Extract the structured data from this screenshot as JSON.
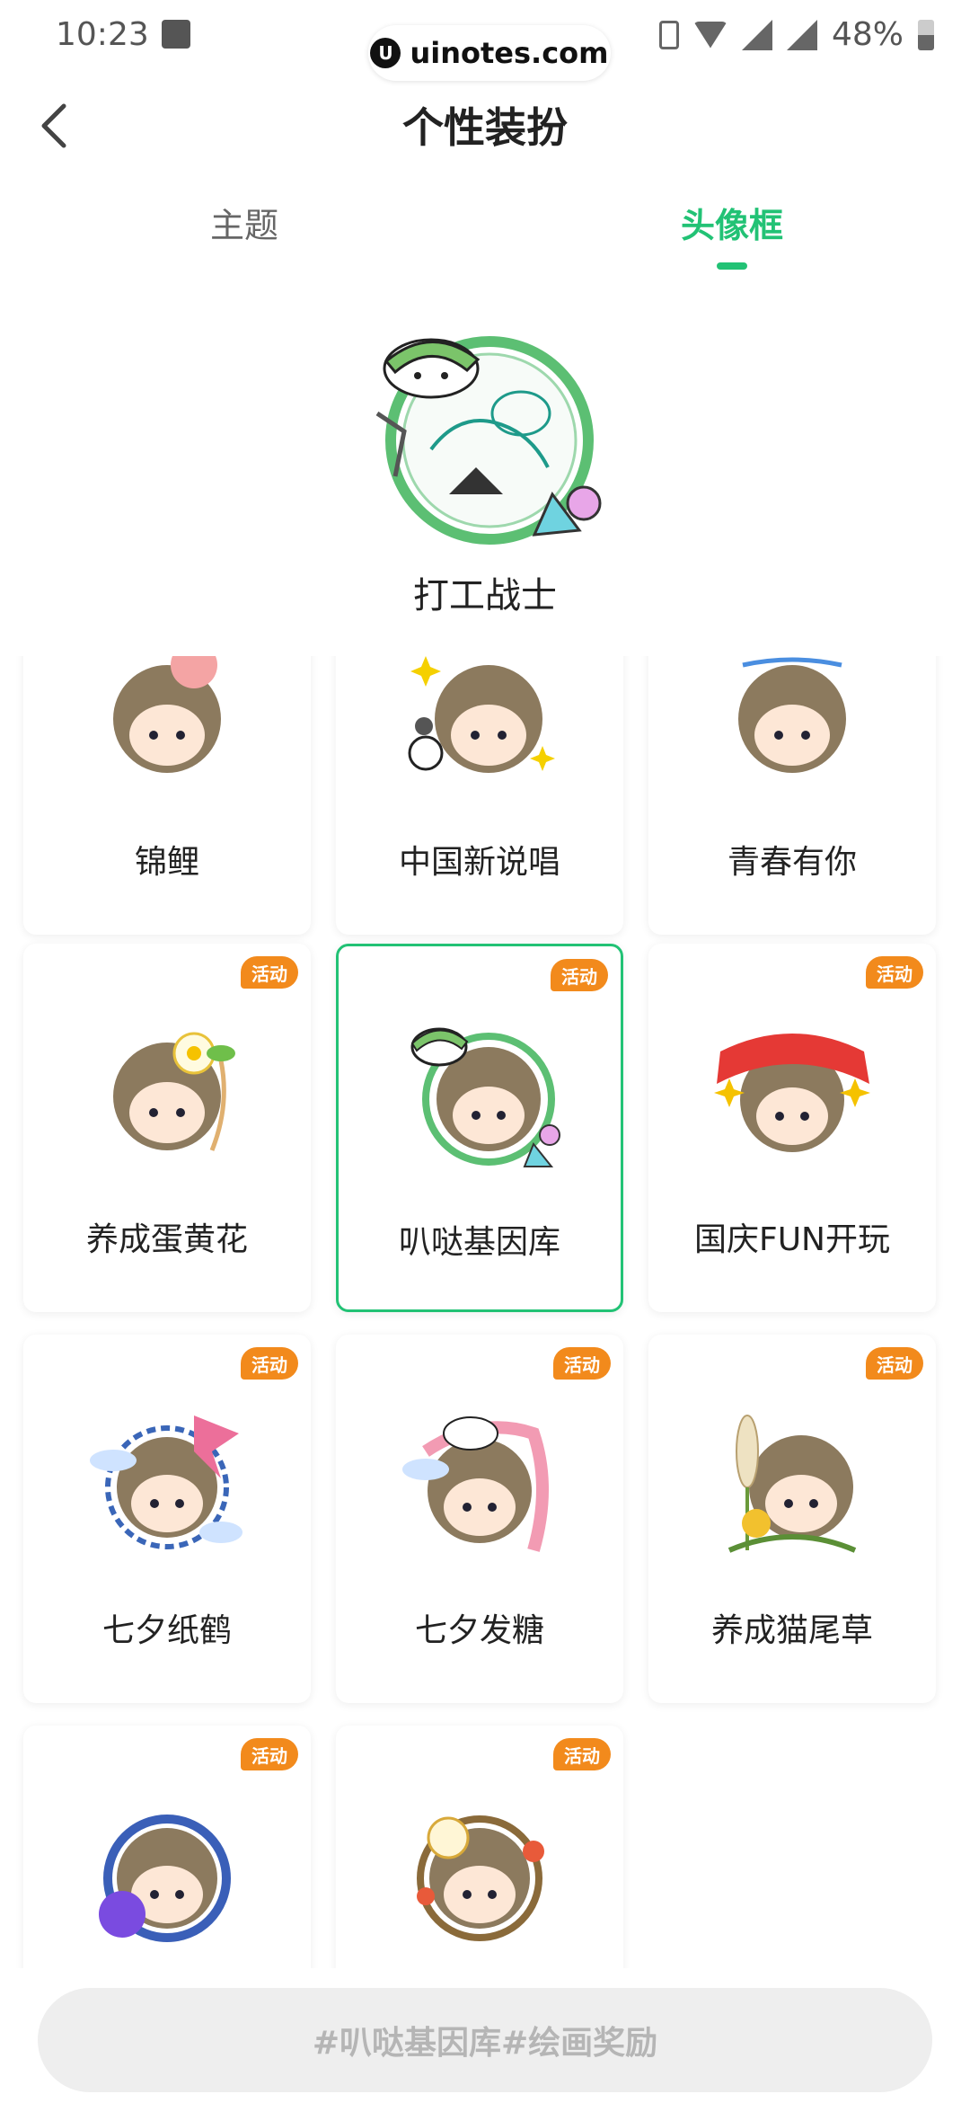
{
  "status_bar": {
    "time": "10:23",
    "battery": "48%",
    "watermark": "uinotes.com"
  },
  "header": {
    "title": "个性装扮"
  },
  "tabs": [
    {
      "label": "主题",
      "active": false
    },
    {
      "label": "头像框",
      "active": true
    }
  ],
  "preview": {
    "name": "打工战士"
  },
  "accent_color": "#22c275",
  "badge_label": "活动",
  "frames": [
    {
      "name": "锦鲤",
      "badge": false,
      "selected": false
    },
    {
      "name": "中国新说唱",
      "badge": false,
      "selected": false
    },
    {
      "name": "青春有你",
      "badge": false,
      "selected": false
    },
    {
      "name": "养成蛋黄花",
      "badge": true,
      "selected": false
    },
    {
      "name": "叭哒基因库",
      "badge": true,
      "selected": true
    },
    {
      "name": "国庆FUN开玩",
      "badge": true,
      "selected": false
    },
    {
      "name": "七夕纸鹤",
      "badge": true,
      "selected": false
    },
    {
      "name": "七夕发糖",
      "badge": true,
      "selected": false
    },
    {
      "name": "养成猫尾草",
      "badge": true,
      "selected": false
    },
    {
      "name": "",
      "badge": true,
      "selected": false
    },
    {
      "name": "",
      "badge": true,
      "selected": false
    }
  ],
  "bottom_button": {
    "label": "#叭哒基因库#绘画奖励"
  }
}
